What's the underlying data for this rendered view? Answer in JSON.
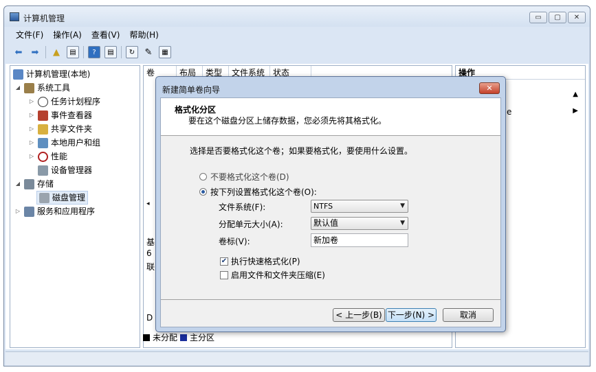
{
  "window": {
    "title": "计算机管理",
    "controls": [
      "▭",
      "▢",
      "✕"
    ]
  },
  "menu": [
    "文件(F)",
    "操作(A)",
    "查看(V)",
    "帮助(H)"
  ],
  "tree": {
    "root": "计算机管理(本地)",
    "system_tools": "系统工具",
    "task_scheduler": "任务计划程序",
    "event_viewer": "事件查看器",
    "shared_folders": "共享文件夹",
    "local_users": "本地用户和组",
    "performance": "性能",
    "device_manager": "设备管理器",
    "storage": "存储",
    "disk_management": "磁盘管理",
    "services_apps": "服务和应用程序"
  },
  "columns": [
    "卷",
    "布局",
    "类型",
    "文件系统",
    "状态"
  ],
  "disk_labels": [
    "基",
    "6",
    "联",
    "D"
  ],
  "legend": {
    "unallocated": "未分配",
    "primary": "主分区"
  },
  "actions": {
    "header": "操作",
    "item_suffix": "e"
  },
  "dialog": {
    "title": "新建简单卷向导",
    "heading": "格式化分区",
    "subheading": "要在这个磁盘分区上储存数据，您必须先将其格式化。",
    "instruction": "选择是否要格式化这个卷；如果要格式化，要使用什么设置。",
    "radio_no_format": "不要格式化这个卷(D)",
    "radio_format": "按下列设置格式化这个卷(O):",
    "fs_label": "文件系统(F):",
    "fs_value": "NTFS",
    "alloc_label": "分配单元大小(A):",
    "alloc_value": "默认值",
    "volume_label": "卷标(V):",
    "volume_value": "新加卷",
    "quick_format": "执行快速格式化(P)",
    "compression": "启用文件和文件夹压缩(E)",
    "back_button": "< 上一步(B)",
    "next_button": "下一步(N) >",
    "cancel_button": "取消"
  }
}
